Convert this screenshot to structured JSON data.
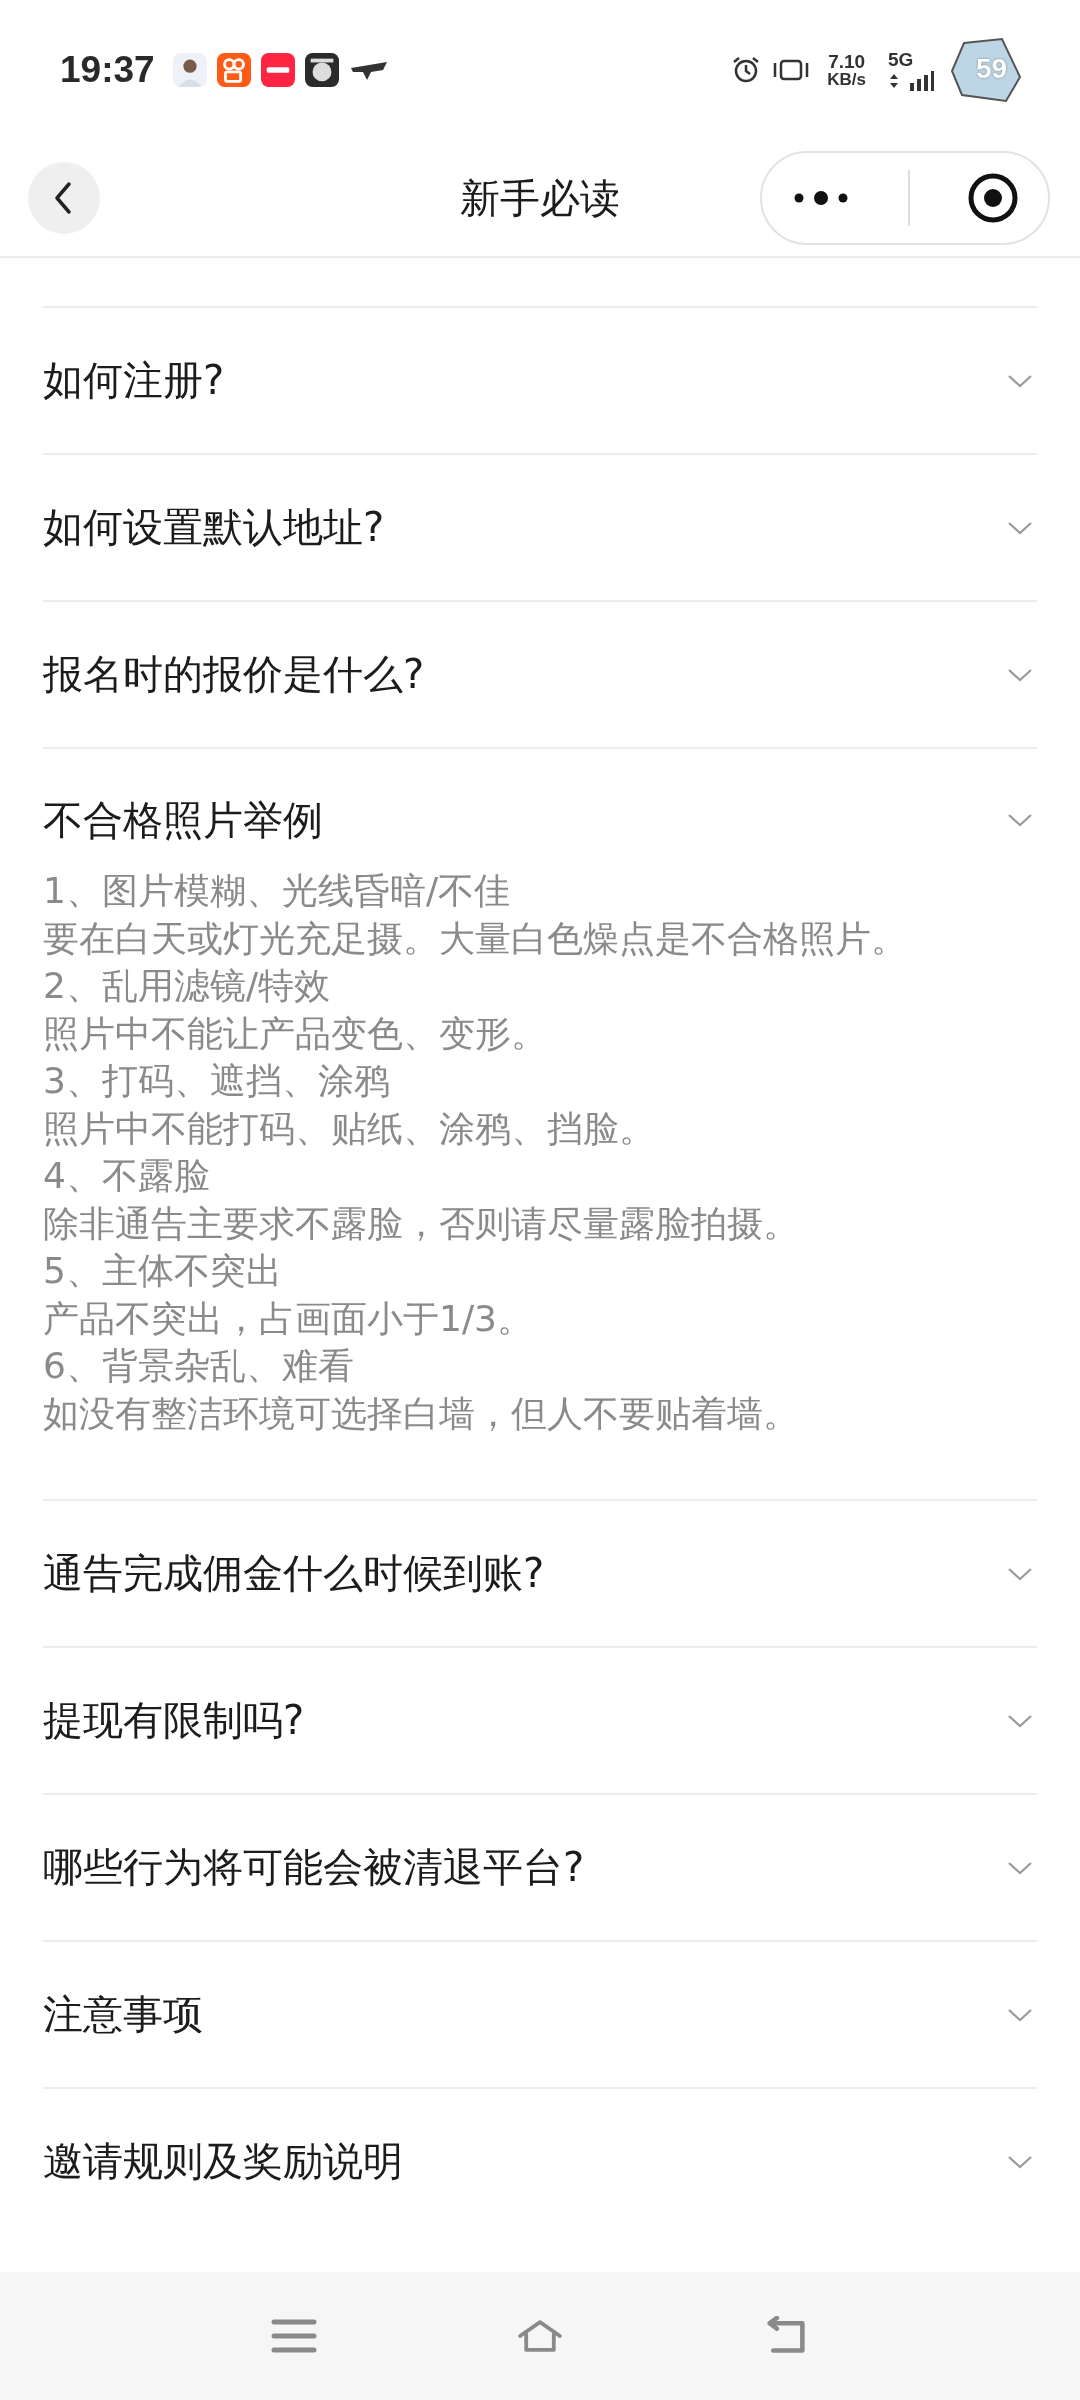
{
  "status_bar": {
    "time": "19:37",
    "speed_value": "7.10",
    "speed_unit": "KB/s",
    "network": "5G",
    "battery": "59"
  },
  "nav": {
    "title": "新手必读"
  },
  "faq": [
    {
      "title": "如何注册?",
      "expanded": false
    },
    {
      "title": "如何设置默认地址?",
      "expanded": false
    },
    {
      "title": "报名时的报价是什么?",
      "expanded": false
    },
    {
      "title": "不合格照片举例",
      "expanded": true,
      "lines": [
        "1、图片模糊、光线昏暗/不佳",
        "要在白天或灯光充足摄。大量白色燥点是不合格照片。",
        "2、乱用滤镜/特效",
        "照片中不能让产品变色、变形。",
        "3、打码、遮挡、涂鸦",
        "照片中不能打码、贴纸、涂鸦、挡脸。",
        "4、不露脸",
        "除非通告主要求不露脸，否则请尽量露脸拍摄。",
        "5、主体不突出",
        "产品不突出，占画面小于1/3。",
        "6、背景杂乱、难看",
        "如没有整洁环境可选择白墙，但人不要贴着墙。"
      ]
    },
    {
      "title": "通告完成佣金什么时候到账?",
      "expanded": false
    },
    {
      "title": "提现有限制吗?",
      "expanded": false
    },
    {
      "title": "哪些行为将可能会被清退平台?",
      "expanded": false
    },
    {
      "title": "注意事项",
      "expanded": false
    },
    {
      "title": "邀请规则及奖励说明",
      "expanded": false
    }
  ]
}
